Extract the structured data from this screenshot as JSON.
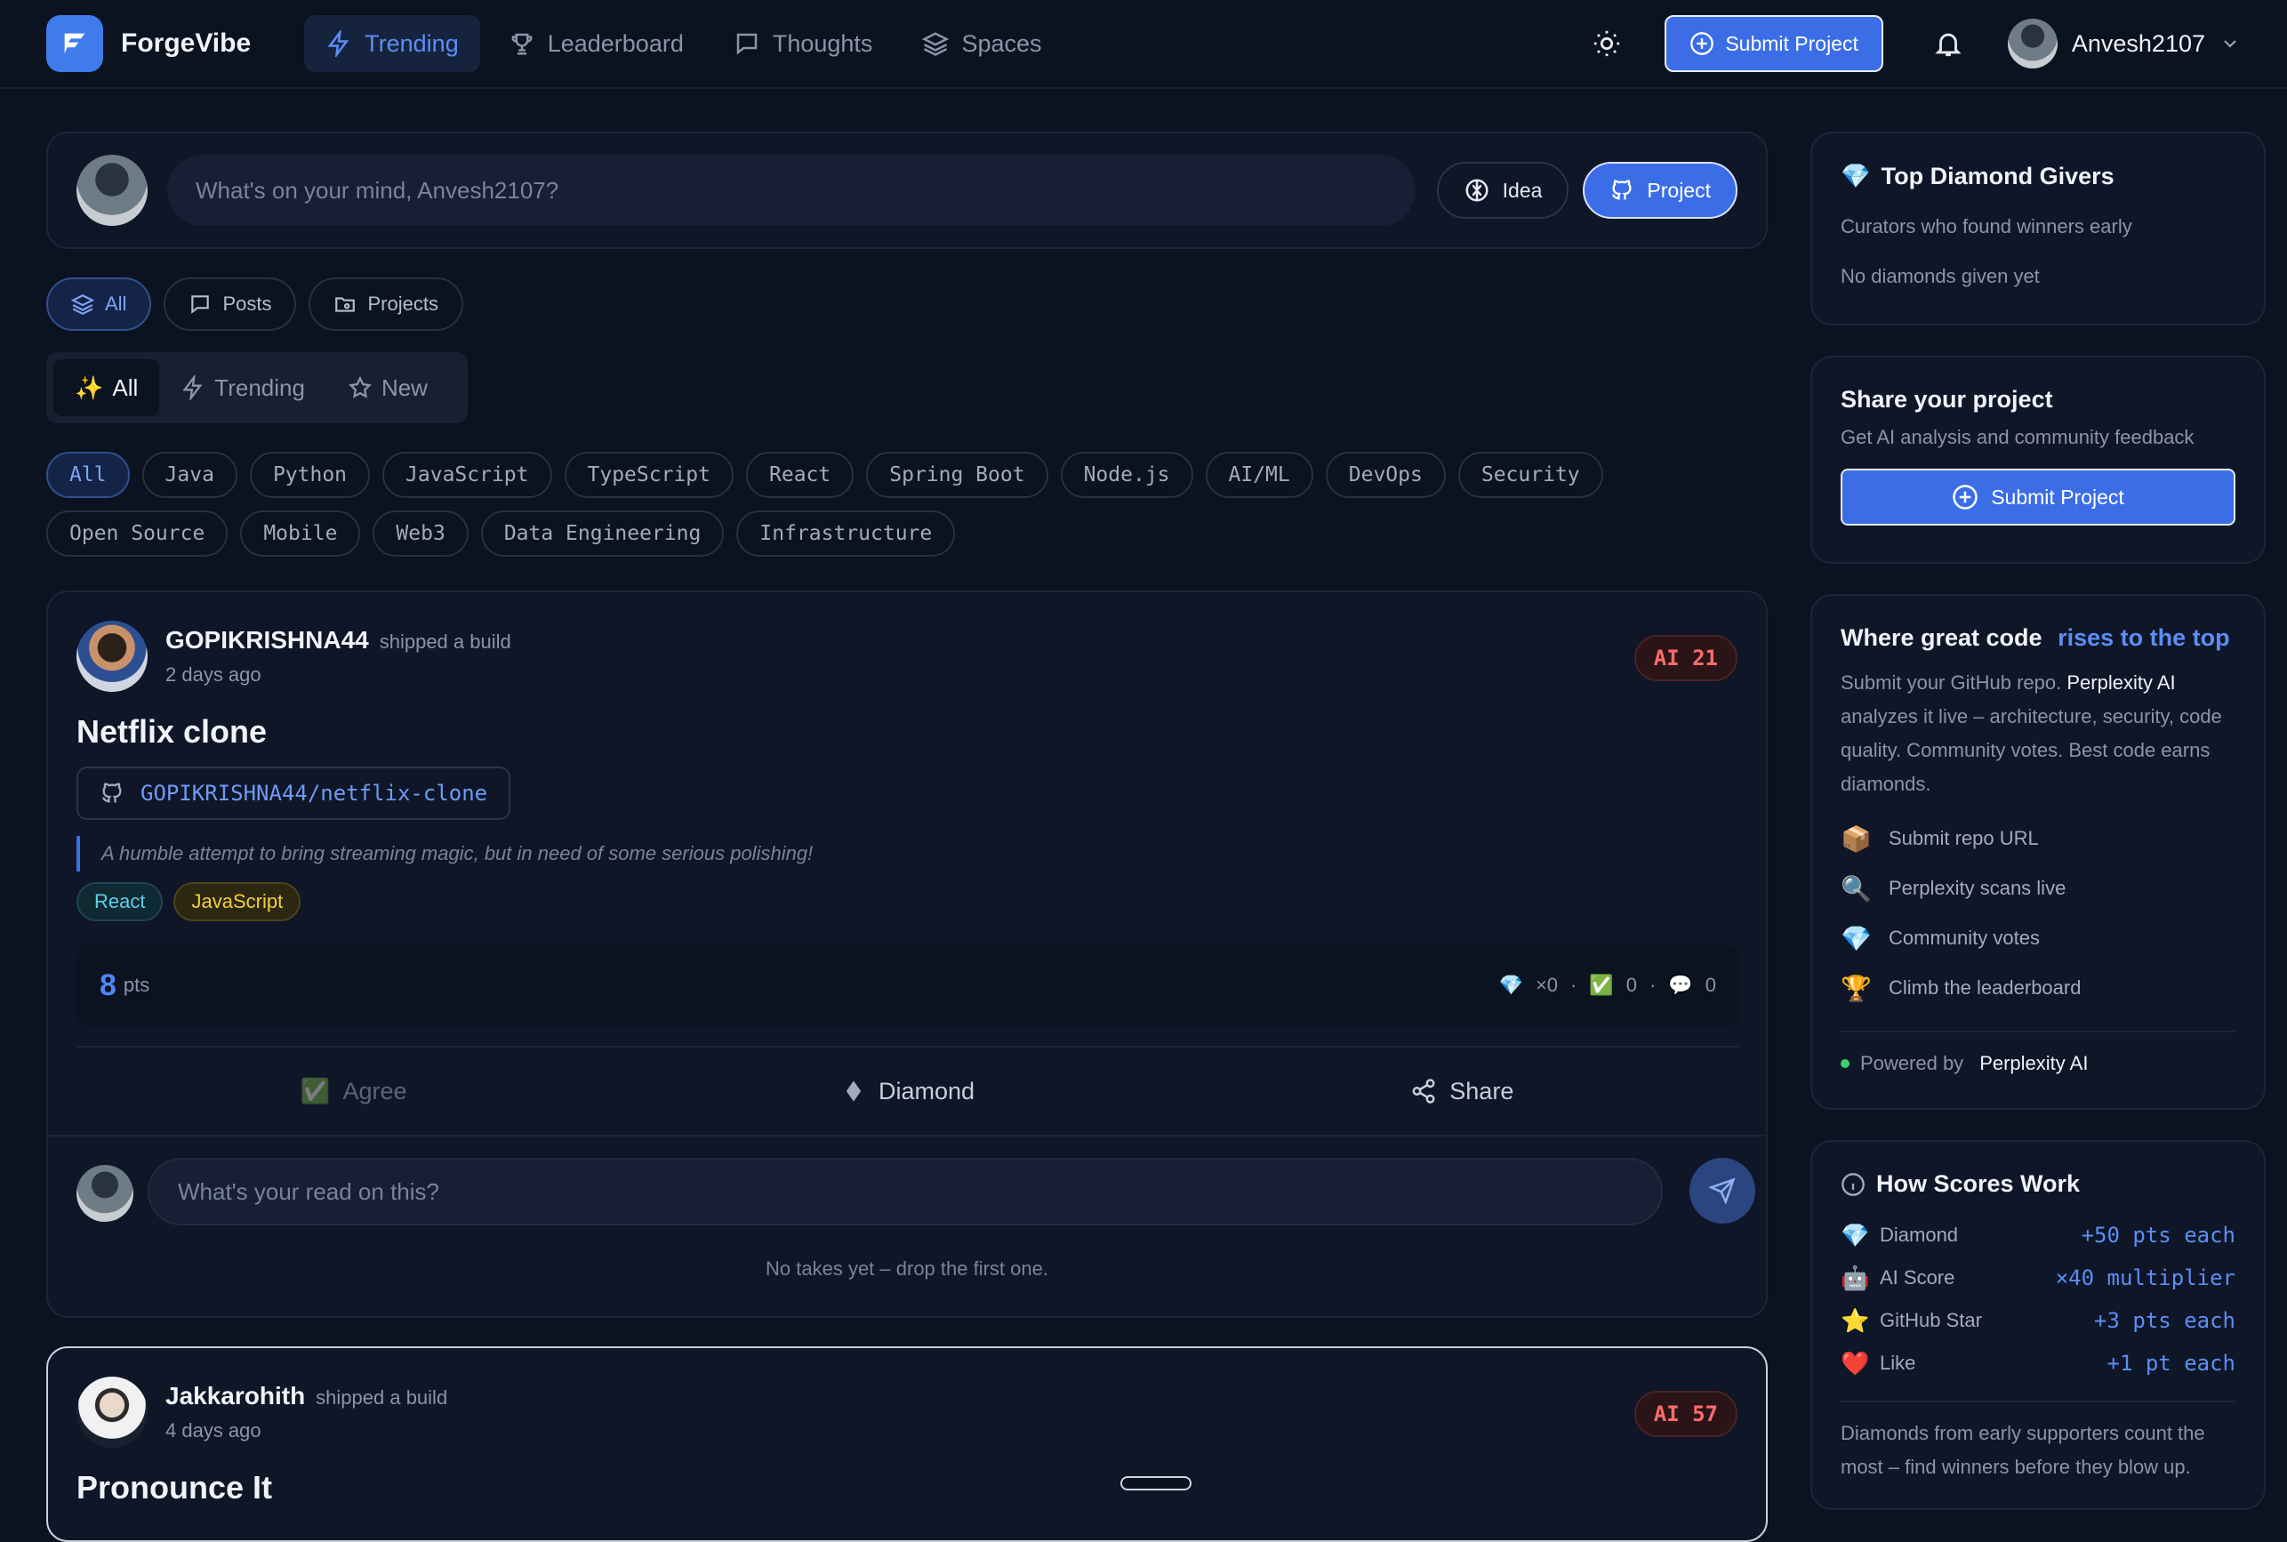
{
  "app": {
    "name": "ForgeVibe"
  },
  "nav": [
    {
      "label": "Trending",
      "icon": "bolt-icon",
      "active": true
    },
    {
      "label": "Leaderboard",
      "icon": "trophy-icon",
      "active": false
    },
    {
      "label": "Thoughts",
      "icon": "chat-icon",
      "active": false
    },
    {
      "label": "Spaces",
      "icon": "layers-icon",
      "active": false
    }
  ],
  "header": {
    "submit_label": "Submit Project",
    "username": "Anvesh2107"
  },
  "composer": {
    "placeholder": "What's on your mind, Anvesh2107?",
    "idea_label": "Idea",
    "project_label": "Project"
  },
  "filters": [
    "All",
    "Posts",
    "Projects"
  ],
  "sort": [
    "All",
    "Trending",
    "New"
  ],
  "tags": [
    "All",
    "Java",
    "Python",
    "JavaScript",
    "TypeScript",
    "React",
    "Spring Boot",
    "Node.js",
    "AI/ML",
    "DevOps",
    "Security",
    "Open Source",
    "Mobile",
    "Web3",
    "Data Engineering",
    "Infrastructure"
  ],
  "post1": {
    "user": "GOPIKRISHNA44",
    "action": "shipped a build",
    "time": "2 days ago",
    "ai_score": "AI 21",
    "title": "Netflix clone",
    "repo": "GOPIKRISHNA44/netflix-clone",
    "quote": "A humble attempt to bring streaming magic, but in need of some serious polishing!",
    "langs": [
      "React",
      "JavaScript"
    ],
    "pts": "8",
    "pts_label": "pts",
    "diamonds": "×0",
    "agrees": "0",
    "comments": "0",
    "actions": {
      "agree": "Agree",
      "diamond": "Diamond",
      "share": "Share"
    },
    "comment_placeholder": "What's your read on this?",
    "no_takes": "No takes yet – drop the first one."
  },
  "post2": {
    "user": "Jakkarohith",
    "action": "shipped a build",
    "time": "4 days ago",
    "ai_score": "AI 57",
    "title": "Pronounce It"
  },
  "sidebar": {
    "diamond_givers": {
      "title": "Top Diamond Givers",
      "subtitle": "Curators who found winners early",
      "empty": "No diamonds given yet"
    },
    "share": {
      "title": "Share your project",
      "subtitle": "Get AI analysis and community feedback",
      "button": "Submit Project"
    },
    "about": {
      "title_a": "Where great code ",
      "title_b": "rises to the top",
      "desc_a": "Submit your GitHub repo. ",
      "desc_b": "Perplexity AI",
      "desc_c": " analyzes it live – architecture, security, code quality. Community votes. Best code earns diamonds.",
      "steps": [
        {
          "icon": "📦",
          "label": "Submit repo URL"
        },
        {
          "icon": "🔍",
          "label": "Perplexity scans live"
        },
        {
          "icon": "💎",
          "label": "Community votes"
        },
        {
          "icon": "🏆",
          "label": "Climb the leaderboard"
        }
      ],
      "powered_a": "Powered by",
      "powered_b": "Perplexity AI"
    },
    "scores": {
      "title": "How Scores Work",
      "rows": [
        {
          "icon": "💎",
          "label": "Diamond",
          "value": "+50 pts each"
        },
        {
          "icon": "🤖",
          "label": "AI Score",
          "value": "×40 multiplier"
        },
        {
          "icon": "⭐",
          "label": "GitHub Star",
          "value": "+3 pts each"
        },
        {
          "icon": "❤️",
          "label": "Like",
          "value": "+1 pt each"
        }
      ],
      "footer": "Diamonds from early supporters count the most – find winners before they blow up."
    }
  },
  "colors": {
    "accent": "#3b6ee6",
    "background": "#0b1220",
    "card": "#0e1627",
    "ai_badge": "#ff6b6b"
  }
}
